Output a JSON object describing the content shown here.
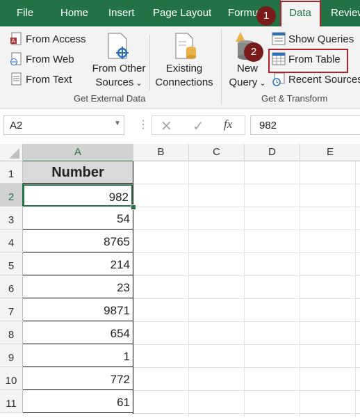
{
  "tabs": {
    "file": "File",
    "home": "Home",
    "insert": "Insert",
    "page_layout": "Page Layout",
    "formulas": "Formulas",
    "data": "Data",
    "review": "Review"
  },
  "get_external_data": {
    "from_access": "From Access",
    "from_web": "From Web",
    "from_text": "From Text",
    "from_other_sources_line1": "From Other",
    "from_other_sources_line2": "Sources",
    "existing_connections_line1": "Existing",
    "existing_connections_line2": "Connections",
    "group_label": "Get External Data"
  },
  "get_transform": {
    "new_query_line1": "New",
    "new_query_line2": "Query",
    "show_queries": "Show Queries",
    "from_table": "From Table",
    "recent_sources": "Recent Sources",
    "group_label": "Get & Transform"
  },
  "annotations": {
    "step1": "1",
    "step2": "2"
  },
  "formula_bar": {
    "name_box": "A2",
    "fx": "fx",
    "value": "982"
  },
  "columns": [
    "A",
    "B",
    "C",
    "D",
    "E"
  ],
  "rows": [
    {
      "num": "1",
      "value": "Number"
    },
    {
      "num": "2",
      "value": "982"
    },
    {
      "num": "3",
      "value": "54"
    },
    {
      "num": "4",
      "value": "8765"
    },
    {
      "num": "5",
      "value": "214"
    },
    {
      "num": "6",
      "value": "23"
    },
    {
      "num": "7",
      "value": "9871"
    },
    {
      "num": "8",
      "value": "654"
    },
    {
      "num": "9",
      "value": "1"
    },
    {
      "num": "10",
      "value": "772"
    },
    {
      "num": "11",
      "value": "61"
    }
  ],
  "colors": {
    "excel_green": "#217346",
    "annotation_red": "#b0222a",
    "badge": "#7a1b1b"
  }
}
